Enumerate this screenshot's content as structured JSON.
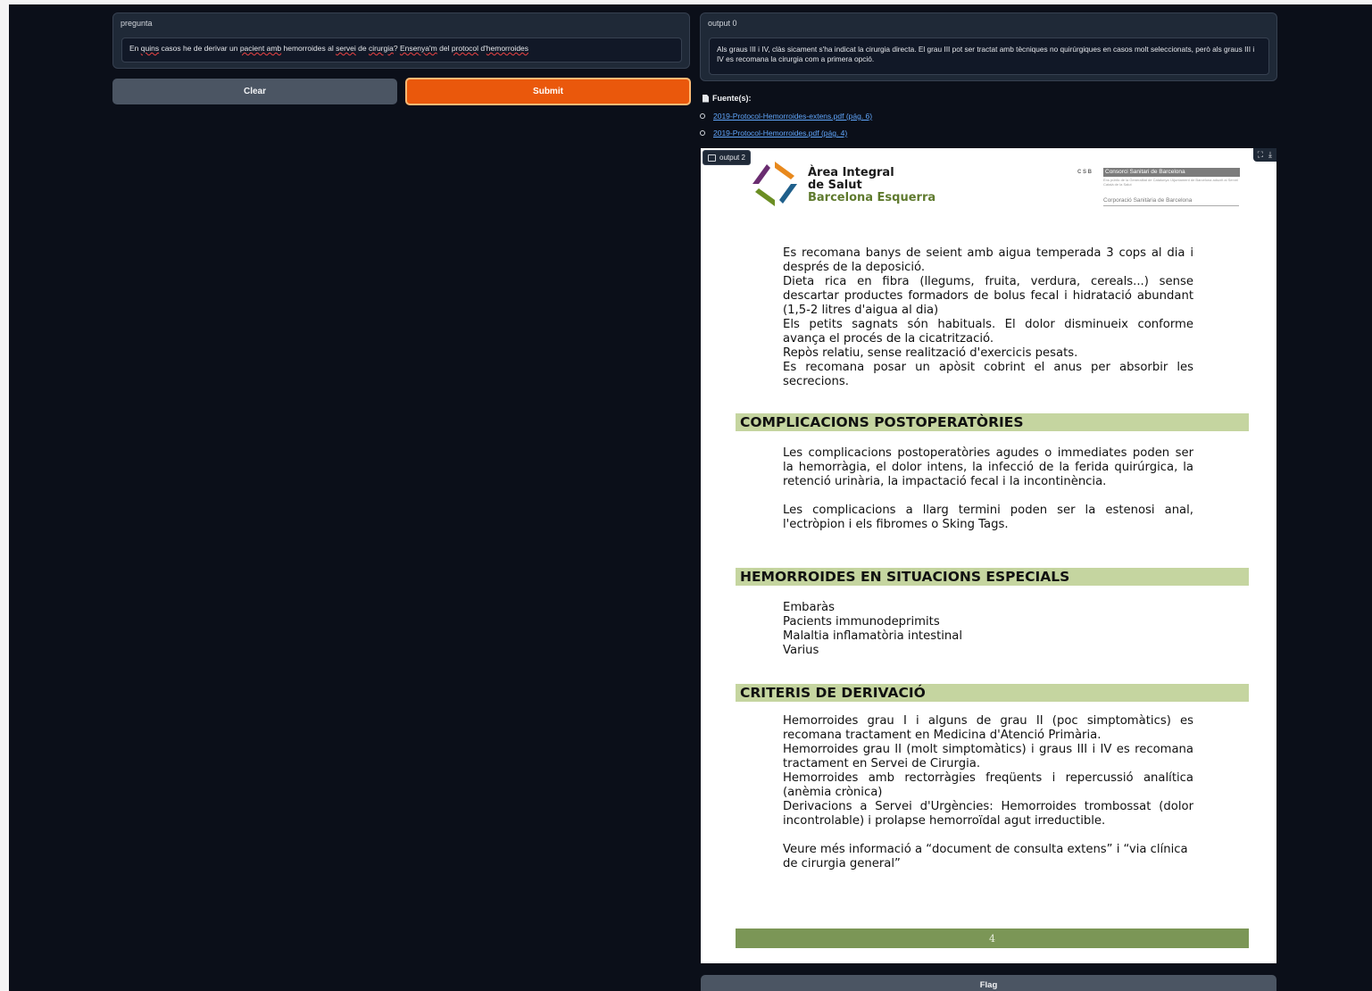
{
  "input_panel": {
    "label": "pregunta",
    "question_parts": [
      "En ",
      "quins",
      " casos he de derivar un ",
      "pacient amb",
      " hemorroides al ",
      "servei",
      " de ",
      "cirurgia",
      "? ",
      "Ensenya'm",
      " del ",
      "protocol",
      " d'",
      "hemorroides"
    ]
  },
  "buttons": {
    "clear": "Clear",
    "submit": "Submit",
    "flag": "Flag"
  },
  "output0": {
    "label": "output 0",
    "text": "Als graus III i IV, clàs sicament s'ha indicat la cirurgia directa. El grau III pot ser tractat amb tècniques no quirúrgiques en casos molt seleccionats, però als graus III i IV es recomana la cirurgia com a primera opció."
  },
  "sources": {
    "heading": "Fuente(s):",
    "items": [
      "2019-Protocol-Hemorroides-extens.pdf (pág. 6)",
      "2019-Protocol-Hemorroides.pdf (pág. 4)"
    ]
  },
  "output2": {
    "label": "output 2",
    "icons": [
      "image-icon",
      "fullscreen-icon",
      "download-icon"
    ]
  },
  "document": {
    "org_name_line1": "Àrea Integral",
    "org_name_line2": "de Salut",
    "org_name_line3": "Barcelona Esquerra",
    "csb_mark": "C S B",
    "csb_title": "Consorci Sanitari de Barcelona",
    "csb_subtitle": "Ens públic de la Generalitat de Catalunya i Ajuntament de Barcelona adscrit al Servei Català de la Salut",
    "corp_name": "Corporació Sanitària de Barcelona",
    "intro_lines": [
      "Es recomana banys de seient amb aigua temperada 3 cops al dia i després de la deposició.",
      "Dieta rica en fibra (llegums, fruita, verdura, cereals...) sense descartar productes formadors de bolus fecal i hidratació abundant (1,5-2 litres d'aigua al dia)",
      "Els petits sagnats són habituals. El dolor disminueix conforme avança el procés de la cicatrització.",
      "Repòs relatiu, sense realització d'exercicis pesats.",
      "Es recomana posar un apòsit cobrint el anus per absorbir les secrecions."
    ],
    "section1_title": "COMPLICACIONS POSTOPERATÒRIES",
    "section1_p1": "Les complicacions postoperatòries agudes o immediates poden ser la hemorràgia, el dolor intens, la infecció de la ferida quirúrgica, la retenció urinària, la impactació fecal i la incontinència.",
    "section1_p2": "Les complicacions a llarg termini poden ser la estenosi anal, l'ectròpion i els fibromes o Sking Tags.",
    "section2_title": "HEMORROIDES EN SITUACIONS ESPECIALS",
    "section2_items": [
      "Embaràs",
      "Pacients immunodeprimits",
      "Malaltia inflamatòria intestinal",
      "Varius"
    ],
    "section3_title": "CRITERIS DE DERIVACIÓ",
    "section3_lines": [
      "Hemorroides grau I i alguns de grau II (poc simptomàtics) es recomana tractament en Medicina d'Atenció Primària.",
      "Hemorroides grau II (molt simptomàtics) i graus III i IV es recomana tractament en Servei de Cirurgia.",
      "Hemorroides amb rectorràgies freqüents i repercussió analítica (anèmia crònica)",
      "Derivacions a Servei d'Urgències:  Hemorroides trombossat (dolor incontrolable) i prolapse hemorroïdal agut irreductible."
    ],
    "section3_footer": "Veure més informació a “document de consulta extens” i “via clínica de cirurgia general”",
    "page_number": "4",
    "colors": {
      "section_bar": "#c5d5a0",
      "footer_bar": "#7b9656",
      "accent_orange": "#ea580c"
    }
  }
}
